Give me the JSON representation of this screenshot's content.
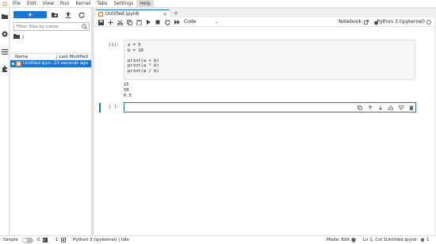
{
  "menu": {
    "items": [
      "File",
      "Edit",
      "View",
      "Run",
      "Kernel",
      "Tabs",
      "Settings",
      "Help"
    ],
    "active": "Help"
  },
  "filebrowser": {
    "new_label": "+",
    "filter_placeholder": "Filter files by name",
    "breadcrumb": "/",
    "col_name": "Name",
    "col_modified": "Last Modified",
    "files": [
      {
        "name": "Untitled.ipyn...",
        "modified": "10 seconds ago"
      }
    ]
  },
  "tabs": [
    {
      "label": "Untitled.ipynb"
    }
  ],
  "notebook": {
    "cell_type": "Code",
    "kernel_label": "Notebook",
    "kernel_name": "Python 3 (ipykernel)",
    "cells": [
      {
        "prompt": "[1]:",
        "source": "a = 5\nb = 10\n\nprint(a + b)\nprint(a * b)\nprint(a / b)",
        "output": "15\n50\n0.5"
      },
      {
        "prompt": "[ ]:",
        "source": ""
      }
    ]
  },
  "status": {
    "mode_label": "Simple",
    "terminals": "0",
    "kernels": "1",
    "kernel_status": "Python 3 (ipykernel) | Idle",
    "edit_mode": "Mode: Edit",
    "cursor": "Ln 1, Col 1",
    "file": "Untitled.ipynb",
    "bell_count": "1"
  },
  "colors": {
    "accent": "#1976d2",
    "prompt": "#303f9f",
    "logo": "#f37726"
  }
}
